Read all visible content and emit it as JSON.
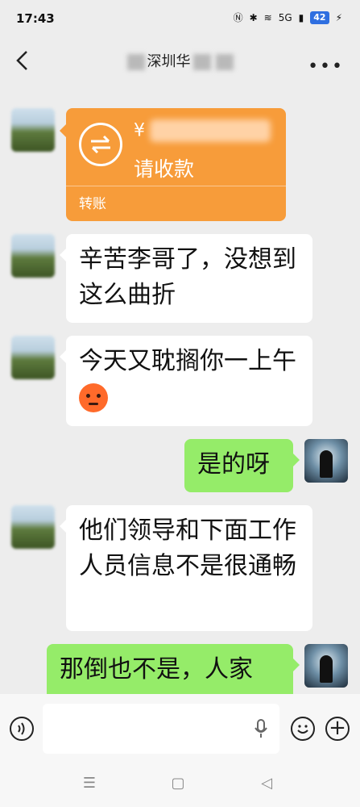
{
  "status_bar": {
    "time": "17:43",
    "net_label": "5G",
    "battery": "42"
  },
  "header": {
    "title_visible": "深圳华"
  },
  "transfer": {
    "currency": "¥",
    "label": "请收款",
    "footer": "转账"
  },
  "messages": [
    {
      "side": "left",
      "text": "辛苦李哥了，没想到这么曲折"
    },
    {
      "side": "left",
      "text": "今天又耽搁你一上午"
    },
    {
      "side": "right",
      "text": "是的呀"
    },
    {
      "side": "left",
      "text": "他们领导和下面工作人员信息不是很通畅"
    },
    {
      "side": "right",
      "text": "那倒也不是，人家"
    }
  ],
  "input": {
    "placeholder": "",
    "value": ""
  },
  "icons": [
    "back-icon",
    "more-icon",
    "transfer-icon",
    "voice-icon",
    "mic-icon",
    "emoji-icon",
    "plus-icon",
    "nav-menu-icon",
    "nav-home-icon",
    "nav-back-icon"
  ]
}
